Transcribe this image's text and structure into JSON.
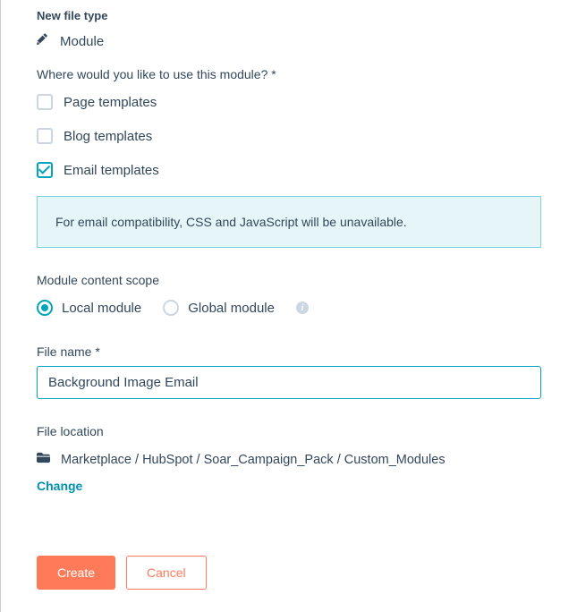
{
  "newFileType": {
    "heading": "New file type",
    "value": "Module"
  },
  "usageQuestion": "Where would you like to use this module? *",
  "templateOptions": {
    "page": "Page templates",
    "blog": "Blog templates",
    "email": "Email templates"
  },
  "emailCompatNotice": "For email compatibility, CSS and JavaScript will be unavailable.",
  "scope": {
    "heading": "Module content scope",
    "local": "Local module",
    "global": "Global module"
  },
  "fileName": {
    "label": "File name *",
    "value": "Background Image Email"
  },
  "fileLocation": {
    "label": "File location",
    "path": "Marketplace / HubSpot / Soar_Campaign_Pack / Custom_Modules",
    "changeLabel": "Change"
  },
  "buttons": {
    "create": "Create",
    "cancel": "Cancel"
  }
}
